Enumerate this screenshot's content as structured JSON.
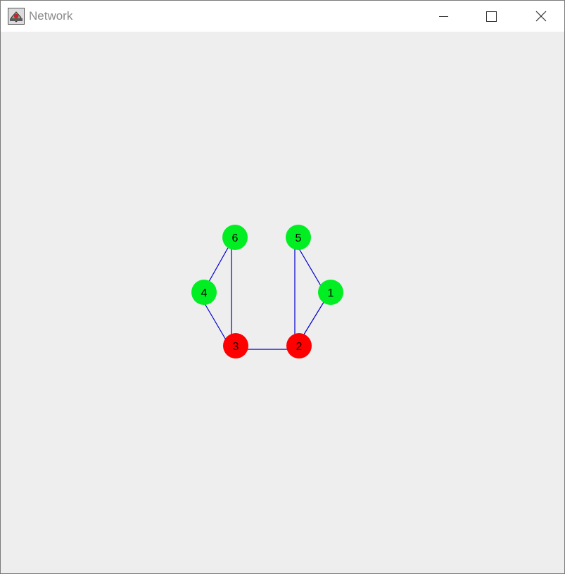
{
  "window": {
    "title": "Network",
    "icon": "java-cup-icon",
    "controls": {
      "minimize_icon": "minimize-icon",
      "maximize_icon": "maximize-icon",
      "close_icon": "close-icon"
    }
  },
  "colors": {
    "canvas_background": "#eeeeee",
    "edge": "#0000cc",
    "node_green": "#00ee22",
    "node_red": "#ff0000"
  },
  "graph": {
    "nodes": [
      {
        "id": "1",
        "label": "1",
        "status": "green"
      },
      {
        "id": "2",
        "label": "2",
        "status": "red"
      },
      {
        "id": "3",
        "label": "3",
        "status": "red"
      },
      {
        "id": "4",
        "label": "4",
        "status": "green"
      },
      {
        "id": "5",
        "label": "5",
        "status": "green"
      },
      {
        "id": "6",
        "label": "6",
        "status": "green"
      }
    ],
    "edges": [
      {
        "from": "6",
        "to": "4"
      },
      {
        "from": "6",
        "to": "3"
      },
      {
        "from": "4",
        "to": "3"
      },
      {
        "from": "3",
        "to": "2"
      },
      {
        "from": "5",
        "to": "2"
      },
      {
        "from": "5",
        "to": "1"
      },
      {
        "from": "1",
        "to": "2"
      }
    ]
  }
}
